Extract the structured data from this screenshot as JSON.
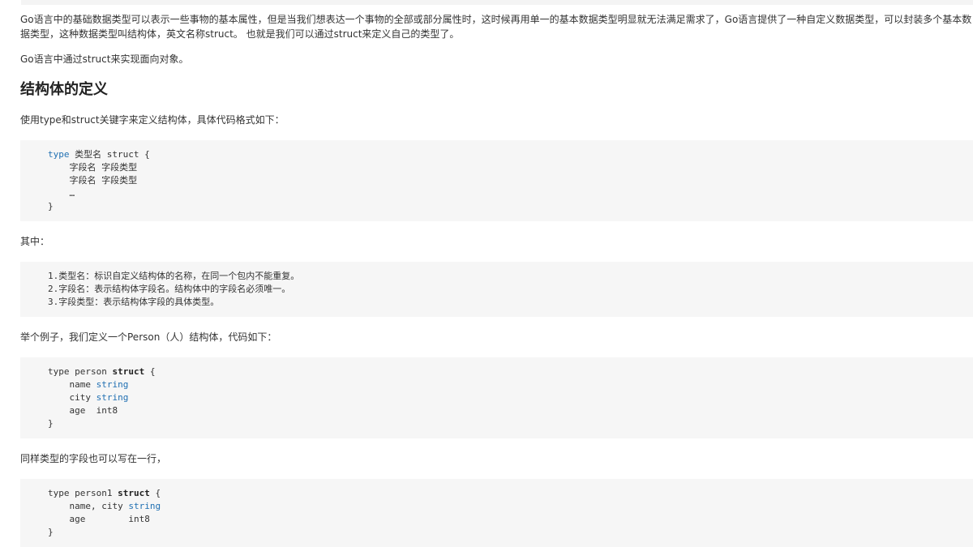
{
  "article": {
    "intro": "Go语言中的基础数据类型可以表示一些事物的基本属性，但是当我们想表达一个事物的全部或部分属性时，这时候再用单一的基本数据类型明显就无法满足需求了，Go语言提供了一种自定义数据类型，可以封装多个基本数据类型，这种数据类型叫结构体，英文名称struct。 也就是我们可以通过struct来定义自己的类型了。",
    "oop": "Go语言中通过struct来实现面向对象。",
    "heading": "结构体的定义",
    "define_intro": "使用type和struct关键字来定义结构体，具体代码格式如下：",
    "code_def": {
      "l1_kw": "type",
      "l1_rest": " 类型名 struct {",
      "l2": "    字段名 字段类型",
      "l3": "    字段名 字段类型",
      "l4": "    …",
      "l5": "}"
    },
    "where_label": "其中：",
    "code_notes": {
      "l1": "1.类型名：标识自定义结构体的名称，在同一个包内不能重复。",
      "l2": "2.字段名：表示结构体字段名。结构体中的字段名必须唯一。",
      "l3": "3.字段类型：表示结构体字段的具体类型。"
    },
    "example_intro": "举个例子，我们定义一个Person（人）结构体，代码如下：",
    "code_person": {
      "l1_pre": "type person ",
      "l1_kw": "struct",
      "l1_post": " {",
      "l2_name": "    name ",
      "l2_type": "string",
      "l3_name": "    city ",
      "l3_type": "string",
      "l4": "    age  int8",
      "l5": "}"
    },
    "same_type_intro": "同样类型的字段也可以写在一行，",
    "code_person1": {
      "l1_pre": "type person1 ",
      "l1_kw": "struct",
      "l1_post": " {",
      "l2_name": "    name, city ",
      "l2_type": "string",
      "l3": "    age        int8",
      "l4": "}"
    }
  },
  "colors": {
    "keyword": "#1f6fb2",
    "code_bg": "#f6f6f6",
    "text": "#333333"
  }
}
